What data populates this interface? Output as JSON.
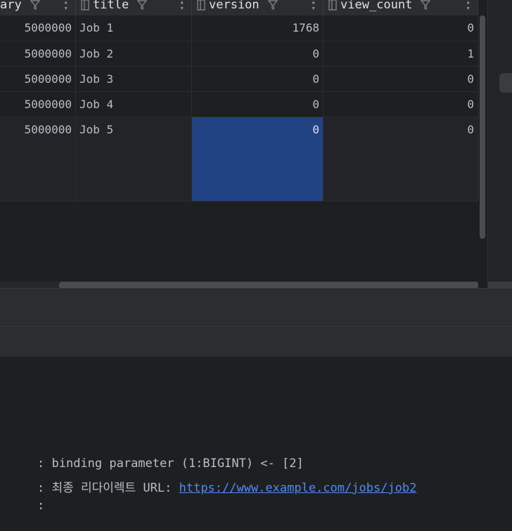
{
  "table": {
    "columns": [
      {
        "label": "ary",
        "icon": "column-icon"
      },
      {
        "label": "title",
        "icon": "column-icon"
      },
      {
        "label": "version",
        "icon": "column-icon"
      },
      {
        "label": "view_count",
        "icon": "column-icon"
      }
    ],
    "rows": [
      {
        "salary": "5000000",
        "title": "Job 1",
        "version": "1768",
        "view_count": "0"
      },
      {
        "salary": "5000000",
        "title": "Job 2",
        "version": "0",
        "view_count": "1"
      },
      {
        "salary": "5000000",
        "title": "Job 3",
        "version": "0",
        "view_count": "0"
      },
      {
        "salary": "5000000",
        "title": "Job 4",
        "version": "0",
        "view_count": "0"
      },
      {
        "salary": "5000000",
        "title": "Job 5",
        "version": "0",
        "view_count": "0"
      }
    ],
    "selected_cell": {
      "row": 5,
      "column": "version"
    }
  },
  "console": {
    "lines": [
      {
        "prefix": ": ",
        "text": "binding parameter (1:BIGINT) <- [2]",
        "link": ""
      },
      {
        "prefix": ": ",
        "text": "최종 리다이렉트 URL: ",
        "link": "https://www.example.com/jobs/job2"
      },
      {
        "prefix": ":",
        "text": "",
        "link": ""
      }
    ]
  },
  "colors": {
    "background": "#1e1f22",
    "header": "#2b2d30",
    "selection": "#214283",
    "link": "#548af7"
  }
}
